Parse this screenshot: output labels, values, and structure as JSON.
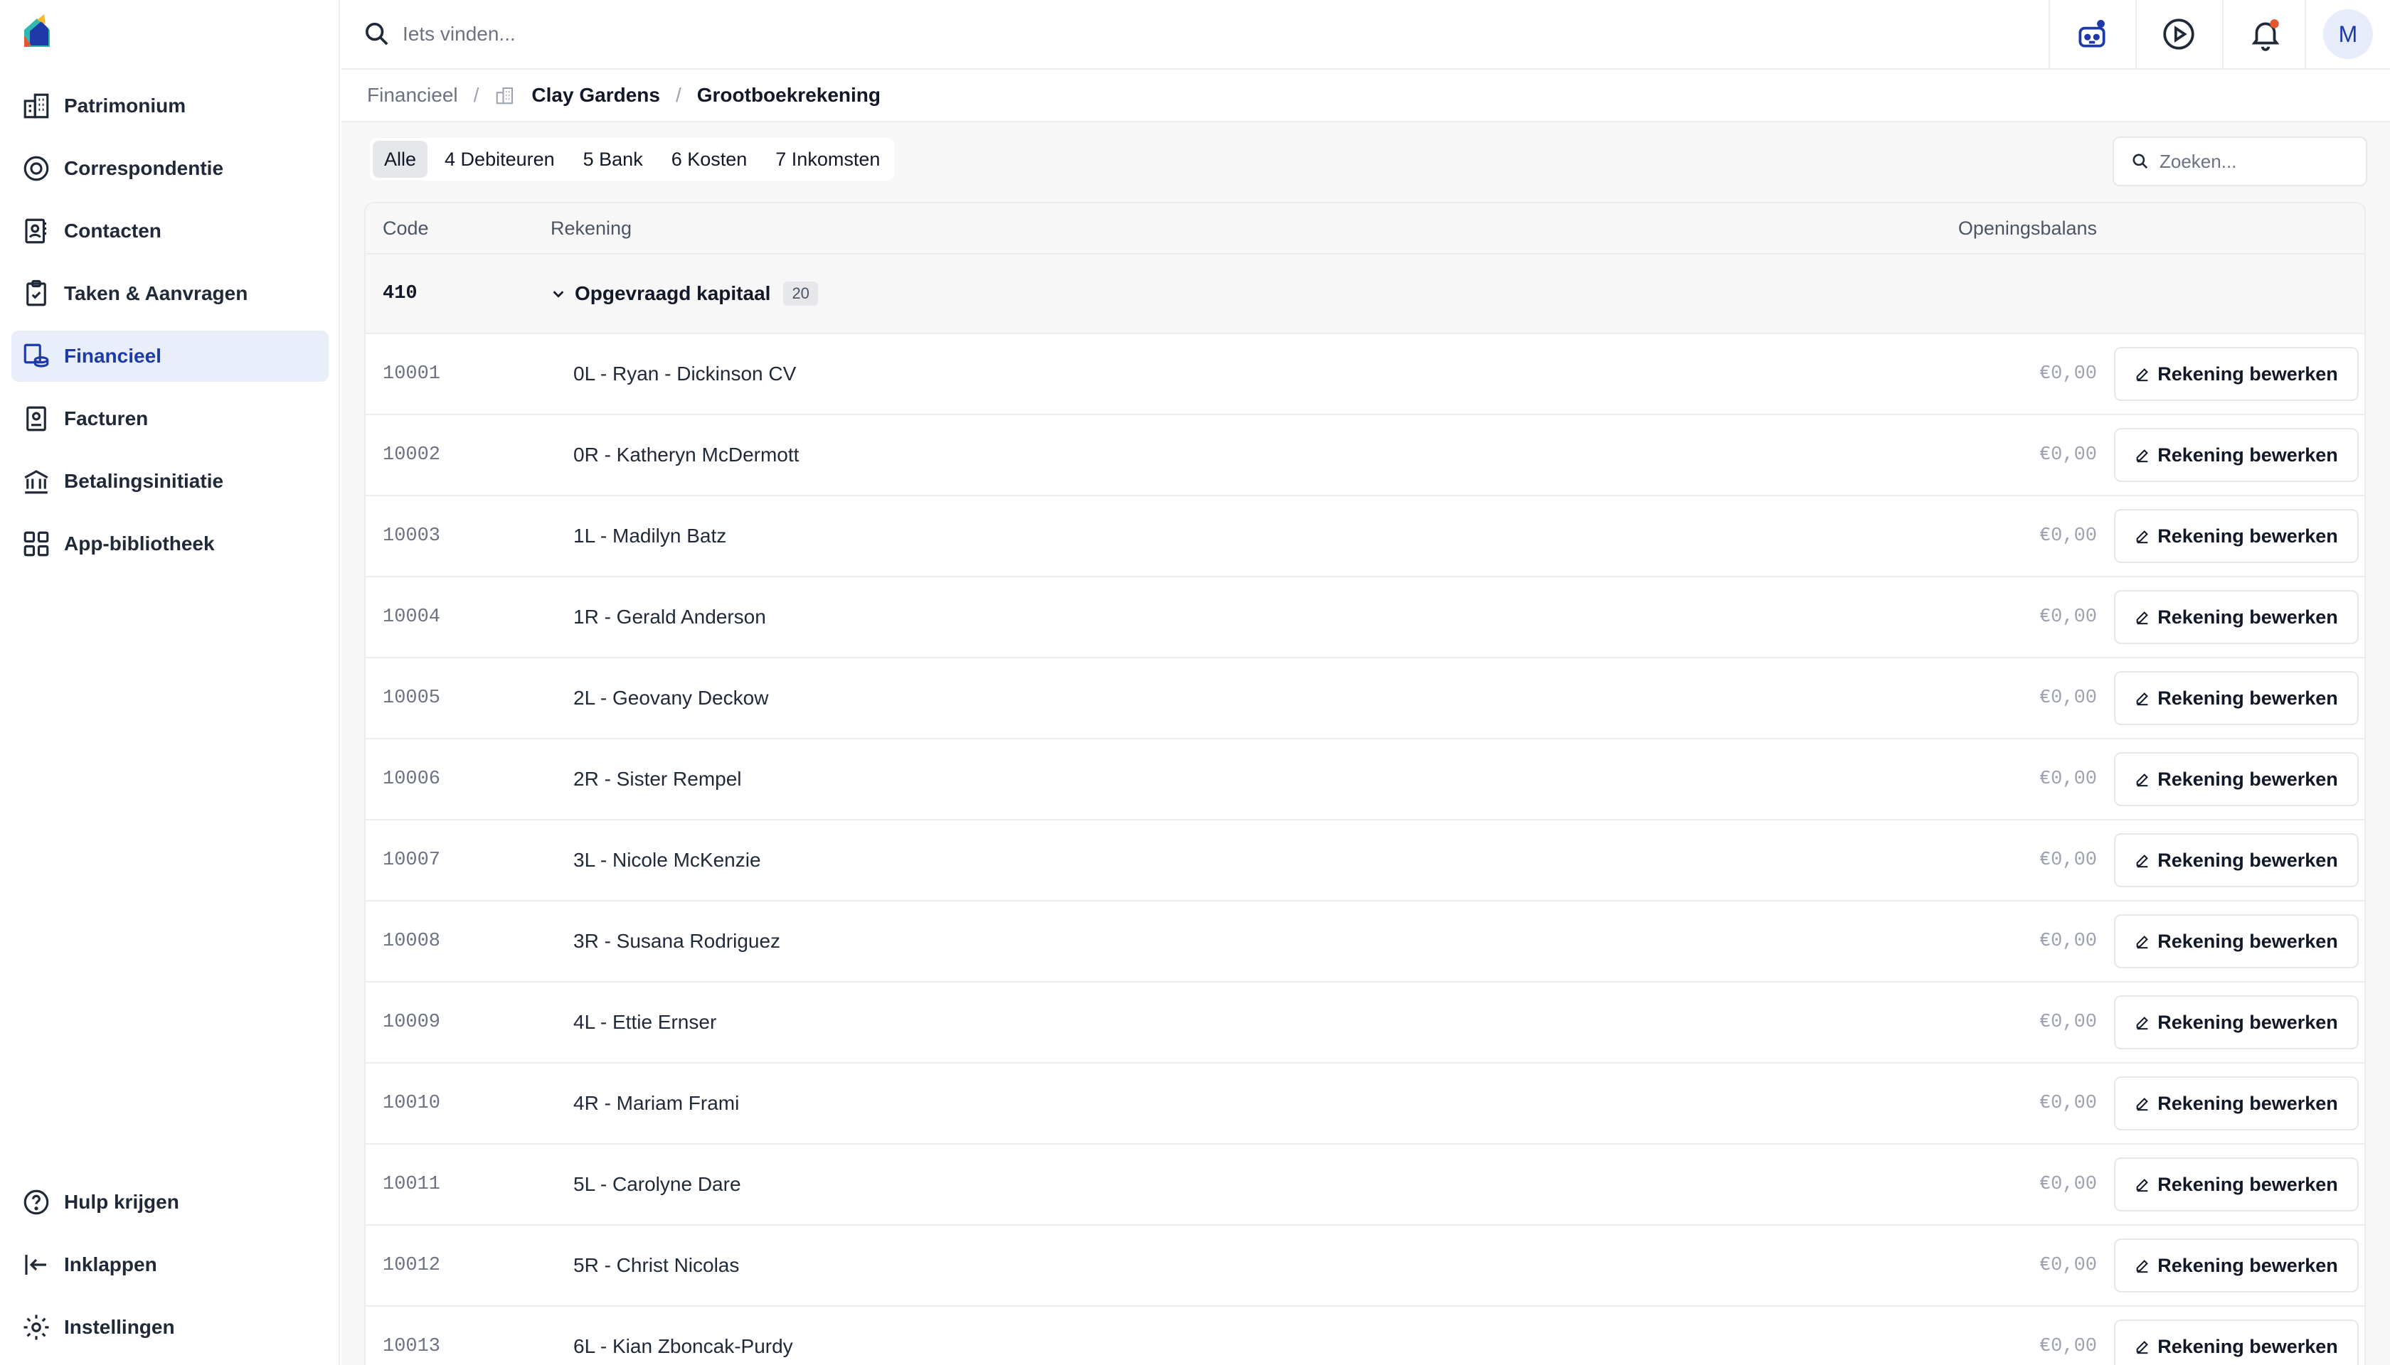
{
  "topbar": {
    "search_placeholder": "Iets vinden...",
    "avatar_initial": "M"
  },
  "sidebar": {
    "items": [
      {
        "label": "Patrimonium",
        "icon": "building-icon"
      },
      {
        "label": "Correspondentie",
        "icon": "correspondence-icon"
      },
      {
        "label": "Contacten",
        "icon": "contacts-icon"
      },
      {
        "label": "Taken & Aanvragen",
        "icon": "clipboard-icon"
      },
      {
        "label": "Financieel",
        "icon": "coins-icon",
        "active": true
      },
      {
        "label": "Facturen",
        "icon": "invoice-icon"
      },
      {
        "label": "Betalingsinitiatie",
        "icon": "bank-icon"
      },
      {
        "label": "App-bibliotheek",
        "icon": "apps-grid-icon"
      }
    ],
    "bottom_items": [
      {
        "label": "Hulp krijgen",
        "icon": "help-icon"
      },
      {
        "label": "Inklappen",
        "icon": "collapse-icon"
      },
      {
        "label": "Instellingen",
        "icon": "gear-icon"
      }
    ]
  },
  "breadcrumb": {
    "root": "Financieel",
    "building": "Clay Gardens",
    "current": "Grootboekrekening"
  },
  "filters": {
    "tabs": [
      "Alle",
      "4 Debiteuren",
      "5 Bank",
      "6 Kosten",
      "7 Inkomsten"
    ],
    "active_index": 0,
    "search_placeholder": "Zoeken..."
  },
  "table": {
    "headers": {
      "code": "Code",
      "account": "Rekening",
      "balance": "Openingsbalans"
    },
    "group": {
      "code": "410",
      "name": "Opgevraagd kapitaal",
      "count": "20"
    },
    "edit_label": "Rekening bewerken",
    "rows": [
      {
        "code": "10001",
        "name": "0L - Ryan - Dickinson CV",
        "balance": "€0,00"
      },
      {
        "code": "10002",
        "name": "0R - Katheryn McDermott",
        "balance": "€0,00"
      },
      {
        "code": "10003",
        "name": "1L - Madilyn Batz",
        "balance": "€0,00"
      },
      {
        "code": "10004",
        "name": "1R - Gerald Anderson",
        "balance": "€0,00"
      },
      {
        "code": "10005",
        "name": "2L - Geovany Deckow",
        "balance": "€0,00"
      },
      {
        "code": "10006",
        "name": "2R - Sister Rempel",
        "balance": "€0,00"
      },
      {
        "code": "10007",
        "name": "3L - Nicole McKenzie",
        "balance": "€0,00"
      },
      {
        "code": "10008",
        "name": "3R - Susana Rodriguez",
        "balance": "€0,00"
      },
      {
        "code": "10009",
        "name": "4L - Ettie Ernser",
        "balance": "€0,00"
      },
      {
        "code": "10010",
        "name": "4R - Mariam Frami",
        "balance": "€0,00"
      },
      {
        "code": "10011",
        "name": "5L - Carolyne Dare",
        "balance": "€0,00"
      },
      {
        "code": "10012",
        "name": "5R - Christ Nicolas",
        "balance": "€0,00"
      },
      {
        "code": "10013",
        "name": "6L - Kian Zboncak-Purdy",
        "balance": "€0,00"
      }
    ]
  },
  "colors": {
    "accent": "#1d3aa8",
    "active_bg": "#e9eefb",
    "notification_dot": "#e4572e"
  }
}
